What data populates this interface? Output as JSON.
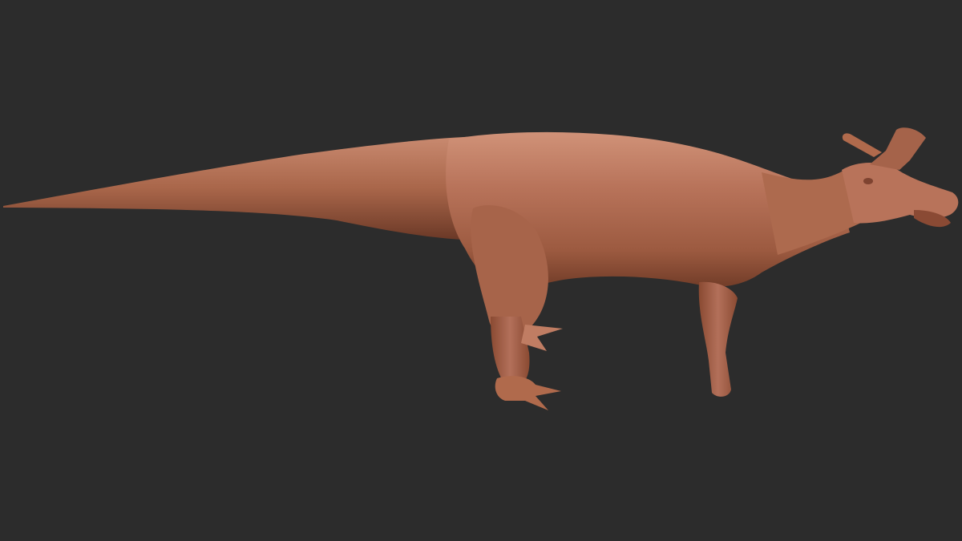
{
  "scene": {
    "background_color": "#2c2c2c",
    "model": {
      "subject": "dinosaur-sculpt",
      "material_base_color": "#b06a4c",
      "material_shadow_color": "#6e3a26",
      "material_highlight_color": "#d4957a"
    }
  }
}
